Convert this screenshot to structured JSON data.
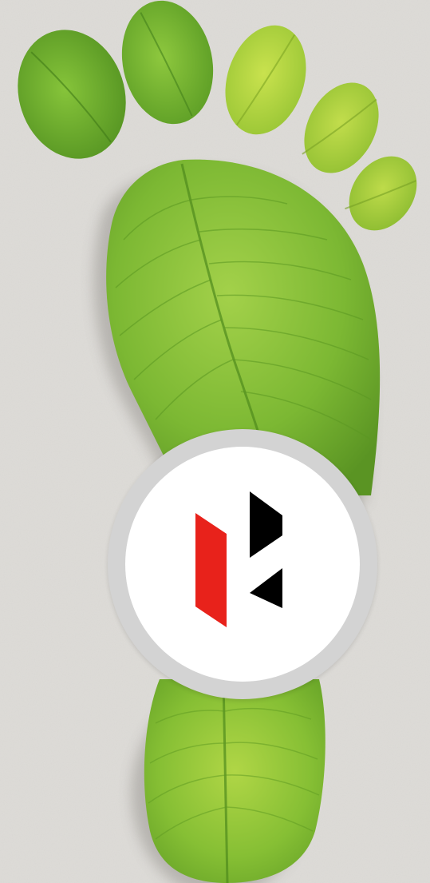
{
  "scene": {
    "subject": "leaf-footprint",
    "background_color": "#d8d6d2",
    "leaf_colors": [
      "#6fae2c",
      "#8cc63f",
      "#a8cf3a"
    ]
  },
  "badge": {
    "ring_color": "#d3d3d3",
    "fill_color": "#ffffff",
    "logo": {
      "name": "brand-logo",
      "primary_color": "#e8221b",
      "secondary_color": "#000000"
    }
  }
}
